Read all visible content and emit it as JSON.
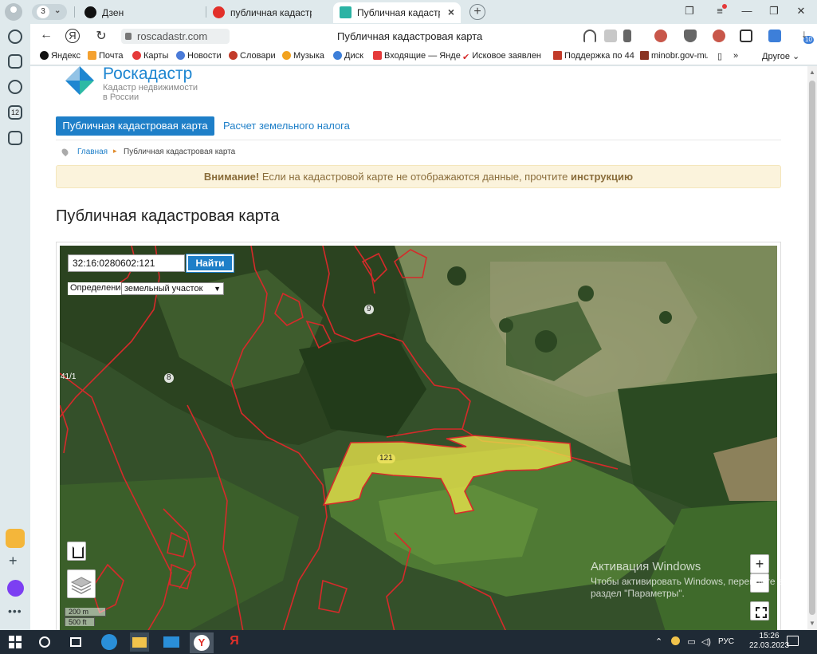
{
  "browser": {
    "tab_counter": "3",
    "tabs": [
      {
        "label": "Дзен",
        "active": false
      },
      {
        "label": "публичная кадастровая к",
        "active": false
      },
      {
        "label": "Публичная кадастровая",
        "active": true
      }
    ],
    "url": "roscadastr.com",
    "page_title": "Публичная кадастровая карта",
    "downloads_badge": "10",
    "bookmarks": [
      "Яндекс",
      "Почта",
      "Карты",
      "Новости",
      "Словари",
      "Музыка",
      "Диск",
      "Входящие — Янде",
      "Исковое заявлен",
      "Поддержка по 44",
      "minobr.gov-mu"
    ],
    "bookmarks_more": "»",
    "bookmarks_other": "Другое"
  },
  "site": {
    "brand": "Роскадастр",
    "brand_sub_1": "Кадастр недвижимости",
    "brand_sub_2": "в России",
    "nav": {
      "primary": "Публичная кадастровая карта",
      "secondary": "Расчет земельного налога"
    },
    "breadcrumb": {
      "home": "Главная",
      "separator": "▸",
      "current": "Публичная кадастровая карта"
    },
    "alert": {
      "strong": "Внимание!",
      "text": " Если на кадастровой карте не отображаются данные, прочтите ",
      "link": "инструкцию"
    },
    "heading": "Публичная кадастровая карта"
  },
  "map": {
    "search_value": "32:16:0280602:121",
    "search_button": "Найти",
    "definition_label": "Определение:",
    "definition_value": "земельный участок",
    "parcel_labels": [
      "9",
      "8",
      "121",
      "41/1"
    ],
    "zoom_in": "+",
    "zoom_out": "−",
    "scale_metric": "200 m",
    "scale_imperial": "500 ft",
    "highlight_color": "#e5e04a",
    "boundary_color": "#d62a2a"
  },
  "watermark": {
    "title": "Активация Windows",
    "line1": "Чтобы активировать Windows, перейдите в",
    "line2": "раздел \"Параметры\"."
  },
  "taskbar": {
    "lang": "РУС",
    "time": "15:26",
    "date": "22.03.2023"
  }
}
